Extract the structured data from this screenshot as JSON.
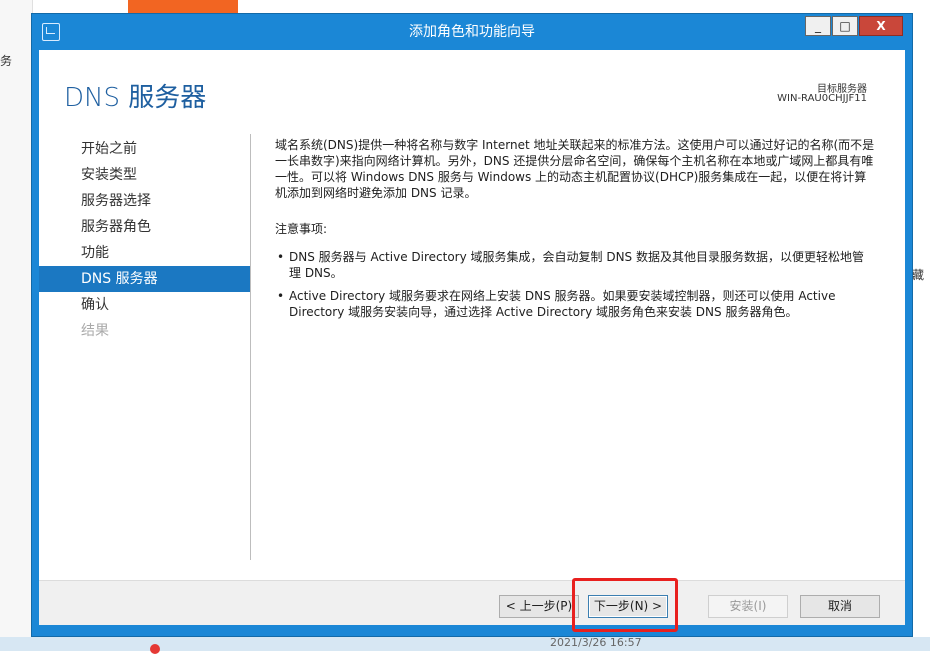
{
  "background": {
    "left_fragment": "务",
    "right_fragment": "藏",
    "bottom_timestamp": "2021/3/26 16:57"
  },
  "dialog": {
    "title": "添加角色和功能向导",
    "controls": {
      "minimize": "_",
      "maximize": "□",
      "close": "X"
    },
    "page_title": "DNS 服务器",
    "target_server_label": "目标服务器",
    "target_server_name": "WIN-RAU0CHJJF11"
  },
  "nav": {
    "items": [
      {
        "label": "开始之前"
      },
      {
        "label": "安装类型"
      },
      {
        "label": "服务器选择"
      },
      {
        "label": "服务器角色"
      },
      {
        "label": "功能"
      },
      {
        "label": "DNS 服务器"
      },
      {
        "label": "确认"
      },
      {
        "label": "结果"
      }
    ],
    "active_index": 5
  },
  "main": {
    "intro": "域名系统(DNS)提供一种将名称与数字 Internet 地址关联起来的标准方法。这使用户可以通过好记的名称(而不是一长串数字)来指向网络计算机。另外，DNS 还提供分层命名空间，确保每个主机名称在本地或广域网上都具有唯一性。可以将 Windows DNS 服务与 Windows 上的动态主机配置协议(DHCP)服务集成在一起，以便在将计算机添加到网络时避免添加 DNS 记录。",
    "notes_heading": "注意事项:",
    "notes": [
      "DNS 服务器与 Active Directory 域服务集成，会自动复制 DNS 数据及其他目录服务数据，以便更轻松地管理 DNS。",
      "Active Directory 域服务要求在网络上安装 DNS 服务器。如果要安装域控制器，则还可以使用 Active Directory 域服务安装向导，通过选择 Active Directory 域服务角色来安装 DNS 服务器角色。"
    ]
  },
  "footer": {
    "prev_label": "< 上一步(P)",
    "next_label": "下一步(N) >",
    "install_label": "安装(I)",
    "cancel_label": "取消"
  },
  "colors": {
    "titlebar": "#1b87d6",
    "accent": "#1b78c2",
    "highlight_box": "#e8201e"
  }
}
